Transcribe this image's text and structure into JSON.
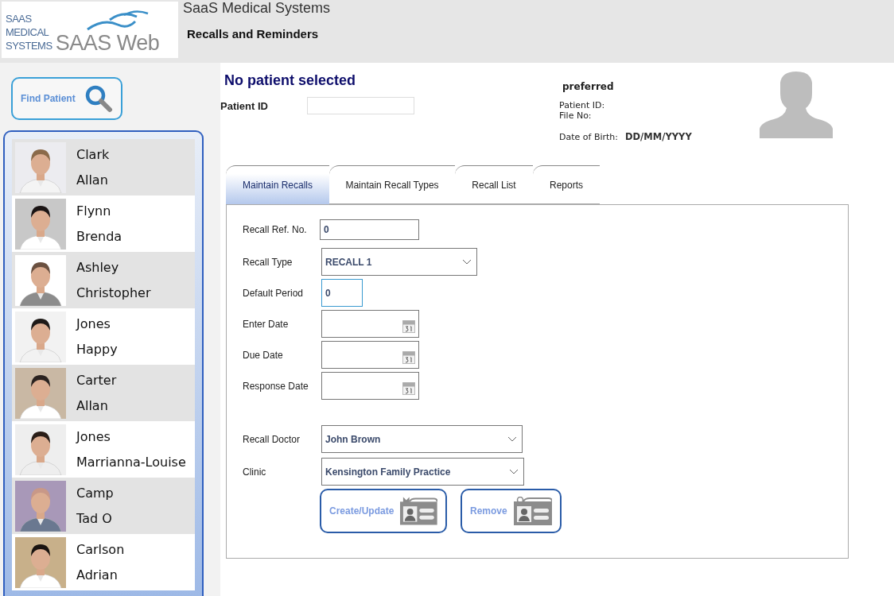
{
  "logo": {
    "lines": [
      "SAAS",
      "MEDICAL",
      "SYSTEMS"
    ],
    "wordmark": "SAAS Web"
  },
  "header": {
    "app_name": "SaaS Medical Systems",
    "page_title": "Recalls and Reminders"
  },
  "sidebar": {
    "find_button": "Find Patient",
    "patients": [
      {
        "surname": "Clark",
        "given_name": "Allan",
        "kind": "picture"
      },
      {
        "surname": "Flynn",
        "given_name": "Brenda",
        "kind": "picture"
      },
      {
        "surname": "Ashley",
        "given_name": "Christopher",
        "kind": "picture"
      },
      {
        "surname": "Jones",
        "given_name": "Happy",
        "kind": "picture"
      },
      {
        "surname": "Carter",
        "given_name": "Allan",
        "kind": "picture"
      },
      {
        "surname": "Jones",
        "given_name": "Marrianna-Louise",
        "kind": "picture"
      },
      {
        "surname": "Camp",
        "given_name": "Tad O",
        "kind": "picture"
      },
      {
        "surname": "Carlson",
        "given_name": "Adrian",
        "kind": "picture"
      }
    ]
  },
  "patient": {
    "heading": "No patient selected",
    "id_label": "Patient ID",
    "preferred": "preferred",
    "patient_id_label": "Patient ID:",
    "file_no_label": "File No:",
    "dob_label": "Date of Birth:",
    "dob_value": "DD/MM/YYYY"
  },
  "tabs": [
    {
      "label": "Maintain Recalls",
      "selected": true
    },
    {
      "label": "Maintain Recall Types",
      "selected": false
    },
    {
      "label": "Recall List",
      "selected": false
    },
    {
      "label": "Reports",
      "selected": false
    }
  ],
  "fields": [
    {
      "label": "Recall Ref. No.",
      "kind": "text",
      "value": "0",
      "focused": false
    },
    {
      "label": "Recall Type",
      "kind": "select",
      "value": "RECALL 1",
      "focused": false
    },
    {
      "label": "Default Period",
      "kind": "text",
      "value": "0",
      "focused": true
    },
    {
      "label": "Enter Date",
      "kind": "date",
      "focused": false
    },
    {
      "label": "Due Date",
      "kind": "date",
      "focused": false
    },
    {
      "label": "Response Date",
      "kind": "date",
      "focused": false
    },
    {
      "label": "Recall Doctor",
      "kind": "select",
      "value": "John Brown",
      "focused": false
    },
    {
      "label": "Clinic",
      "kind": "select",
      "value": "Kensington Family Practice",
      "focused": false
    }
  ],
  "buttons": [
    {
      "label": "Create/Update",
      "kind": "add"
    },
    {
      "label": "Remove",
      "kind": "remove"
    }
  ]
}
